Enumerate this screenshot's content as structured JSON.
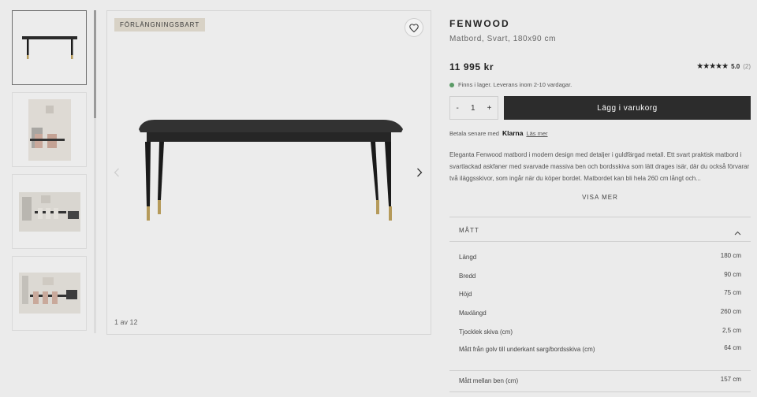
{
  "gallery": {
    "badge": "FÖRLÄNGNINGSBART",
    "counter": "1 av 12",
    "thumbnails": [
      "table-front",
      "dining-room-corner",
      "dining-room-wide",
      "dining-room-side"
    ]
  },
  "product": {
    "brand": "FENWOOD",
    "subtitle": "Matbord, Svart, 180x90 cm",
    "price": "11 995 kr",
    "rating": {
      "stars": "★★★★★",
      "score": "5.0",
      "count": "(2)"
    },
    "stock": "Finns i lager. Leverans inom 2-10 vardagar.",
    "quantity": {
      "minus": "-",
      "value": "1",
      "plus": "+"
    },
    "cart_button": "Lägg i varukorg",
    "klarna": {
      "text": "Betala senare med",
      "logo": "Klarna",
      "link": "Läs mer"
    },
    "description": "Eleganta Fenwood matbord i modern design med detaljer i guldfärgad metall. Ett svart praktisk matbord i svartlackad askfaner med svarvade massiva ben och bordsskiva som lätt drages isär, där du också förvarar två iläggsskivor, som ingår när du köper bordet. Matbordet kan bli hela 260 cm långt och...",
    "show_more": "VISA MER"
  },
  "dimensions": {
    "heading": "MÅTT",
    "rows": [
      {
        "label": "Längd",
        "value": "180 cm"
      },
      {
        "label": "Bredd",
        "value": "90 cm"
      },
      {
        "label": "Höjd",
        "value": "75 cm"
      },
      {
        "label": "Maxlängd",
        "value": "260 cm"
      },
      {
        "label": "Tjocklek skiva (cm)",
        "value": "2,5 cm"
      },
      {
        "label": "Mått från golv till underkant sarg/bordsskiva (cm)",
        "value": "64 cm"
      },
      {
        "label": "Mått mellan ben (cm)",
        "value": "157 cm"
      }
    ]
  },
  "colors": {
    "accent": "#2c2c2c",
    "stock_dot": "#5a9a66",
    "badge_bg": "#d8d2c6"
  }
}
